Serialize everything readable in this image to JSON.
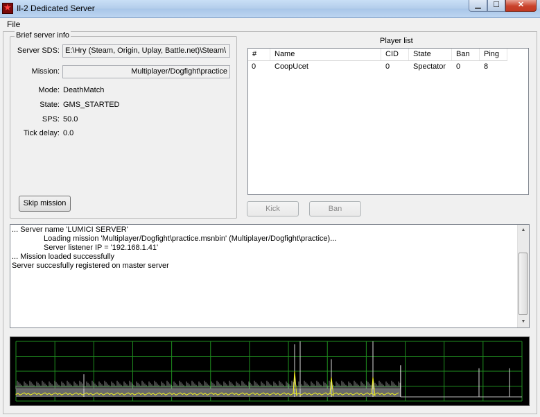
{
  "window": {
    "title": "Il-2 Dedicated Server",
    "min_glyph": "▁",
    "max_glyph": "☐",
    "close_glyph": "✕"
  },
  "menu": {
    "file": "File"
  },
  "info": {
    "legend": "Brief server info",
    "sds_label": "Server SDS:",
    "sds_value": "E:\\Hry (Steam, Origin, Uplay, Battle.net)\\Steam\\",
    "mission_label": "Mission:",
    "mission_value": "Multiplayer/Dogfight\\practice",
    "mode_label": "Mode:",
    "mode_value": "DeathMatch",
    "state_label": "State:",
    "state_value": "GMS_STARTED",
    "sps_label": "SPS:",
    "sps_value": "50.0",
    "tick_label": "Tick delay:",
    "tick_value": "0.0",
    "skip_button": "Skip mission"
  },
  "players": {
    "title": "Player list",
    "columns": [
      "#",
      "Name",
      "CID",
      "State",
      "Ban",
      "Ping"
    ],
    "rows": [
      {
        "num": "0",
        "name": "CoopUcet",
        "cid": "0",
        "state": "Spectator",
        "ban": "0",
        "ping": "8"
      }
    ],
    "kick_button": "Kick",
    "ban_button": "Ban"
  },
  "log": {
    "lines": [
      "... Server name 'LUMICI SERVER'",
      "Loading mission 'Multiplayer/Dogfight\\practice.msnbin' (Multiplayer/Dogfight\\practice)...",
      "Server listener IP = '192.168.1.41'",
      "... Mission loaded successfully",
      "Server succesfully registered on master server"
    ]
  },
  "colors": {
    "graph_background": "#000000",
    "graph_grid": "#1f8f1f",
    "graph_line": "#f0f020",
    "graph_spikes": "#d8d8d8"
  }
}
